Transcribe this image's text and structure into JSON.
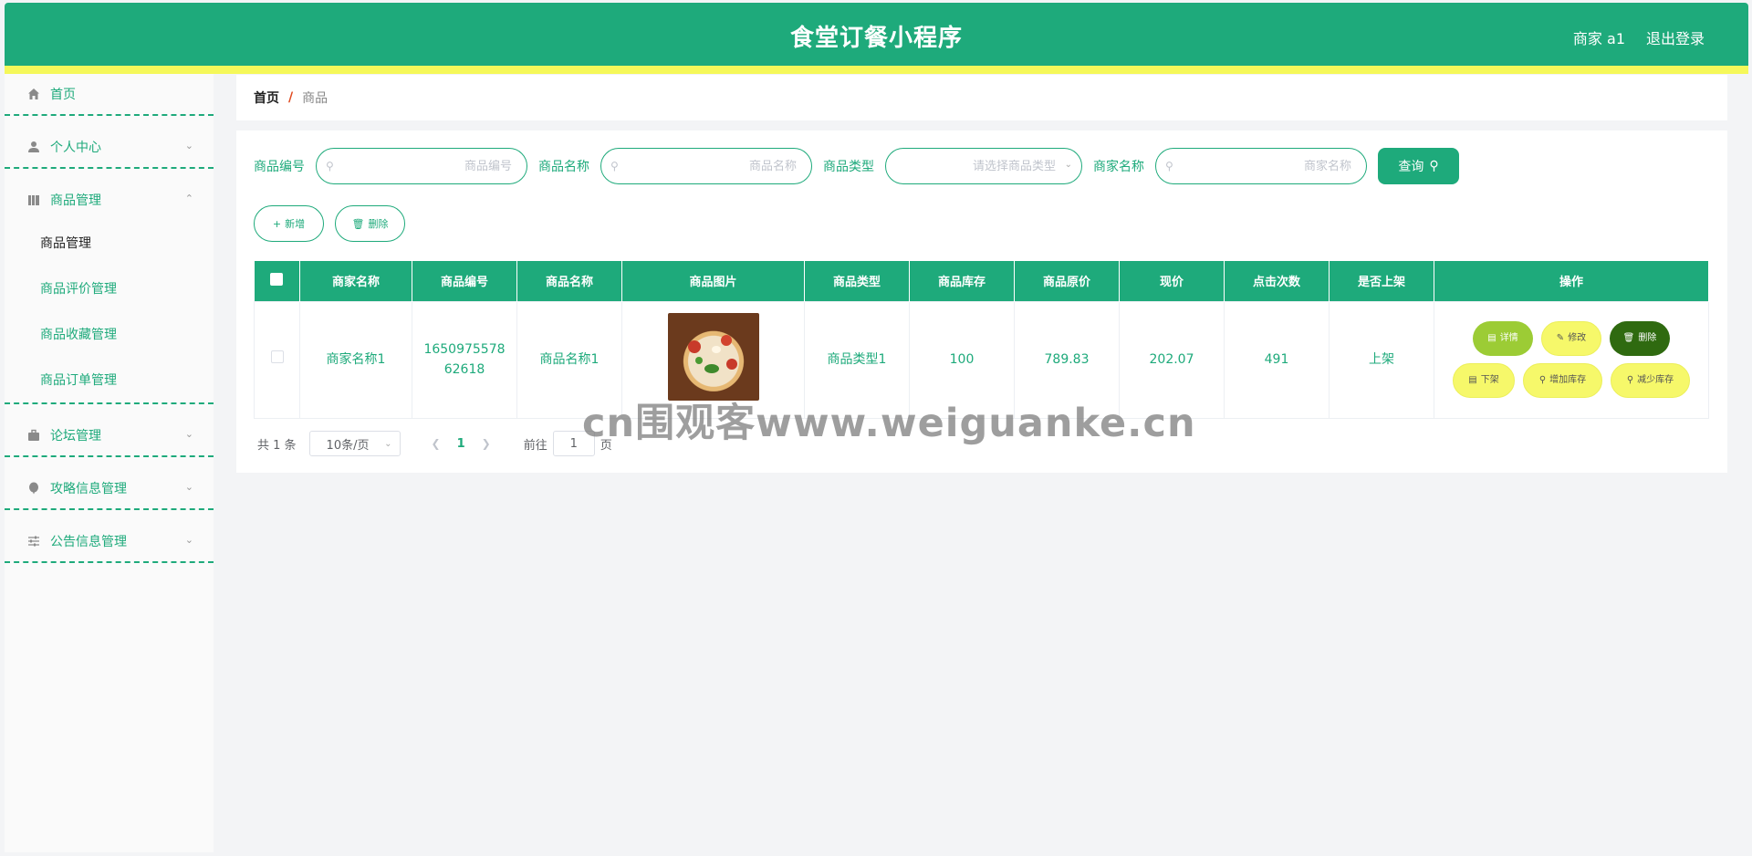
{
  "header": {
    "title": "食堂订餐小程序",
    "user": "商家 a1",
    "logout": "退出登录"
  },
  "sidebar": {
    "home": "首页",
    "groups": [
      {
        "label": "个人中心",
        "icon": "person-icon"
      },
      {
        "label": "商品管理",
        "icon": "book-icon",
        "items": [
          "商品管理",
          "商品评价管理",
          "商品收藏管理",
          "商品订单管理"
        ]
      },
      {
        "label": "论坛管理",
        "icon": "briefcase-icon"
      },
      {
        "label": "攻略信息管理",
        "icon": "balloon-icon"
      },
      {
        "label": "公告信息管理",
        "icon": "sliders-icon"
      }
    ]
  },
  "breadcrumb": {
    "home": "首页",
    "separator": "/",
    "current": "商品"
  },
  "search": {
    "code_label": "商品编号",
    "code_placeholder": "商品编号",
    "name_label": "商品名称",
    "name_placeholder": "商品名称",
    "type_label": "商品类型",
    "type_placeholder": "请选择商品类型",
    "merchant_label": "商家名称",
    "merchant_placeholder": "商家名称",
    "query": "查询"
  },
  "actions": {
    "add": "新增",
    "delete": "删除"
  },
  "table": {
    "headers": [
      "商家名称",
      "商品编号",
      "商品名称",
      "商品图片",
      "商品类型",
      "商品库存",
      "商品原价",
      "现价",
      "点击次数",
      "是否上架",
      "操作"
    ],
    "rows": [
      {
        "merchant": "商家名称1",
        "code": "165097557862618",
        "name": "商品名称1",
        "type": "商品类型1",
        "stock": "100",
        "original_price": "789.83",
        "price": "202.07",
        "clicks": "491",
        "on_shelf": "上架",
        "ops": {
          "detail": "详情",
          "edit": "修改",
          "delete": "删除",
          "down": "下架",
          "add_stock": "增加库存",
          "sub_stock": "减少库存"
        }
      }
    ]
  },
  "pagination": {
    "total": "共 1 条",
    "page_size": "10条/页",
    "current": "1",
    "goto": "前往",
    "goto_value": "1",
    "unit": "页"
  },
  "watermark": "cn围观客www.weiguanke.cn",
  "colors": {
    "primary": "#1eaa7b",
    "accent_strip": "#f5f85a",
    "detail_btn": "#9ccc35",
    "delete_btn": "#2f6a10",
    "yellow_btn": "#f6f86a"
  }
}
